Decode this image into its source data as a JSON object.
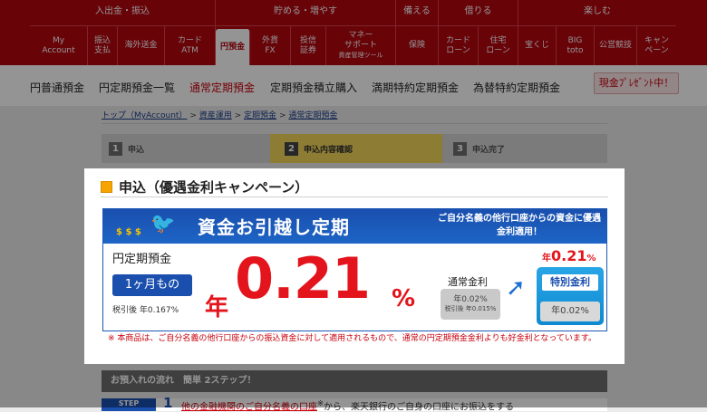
{
  "nav": {
    "categories": [
      "入出金・振込",
      "貯める・増やす",
      "備える",
      "借りる",
      "楽しむ"
    ],
    "items": [
      "My\nAccount",
      "振込\n支払",
      "海外送金",
      "カード\nATM",
      "円預金",
      "外貨\nFX",
      "投信\n証券",
      "マネー\nサポート",
      "保険",
      "カード\nローン",
      "住宅\nローン",
      "宝くじ",
      "BIG\ntoto",
      "公営競技",
      "キャン\nペーン"
    ],
    "money_support_sub": "資産管理ツール"
  },
  "subnav": {
    "links": [
      "円普通預金",
      "円定期預金一覧",
      "通常定期預金",
      "定期預金積立購入",
      "満期特約定期預金",
      "為替特約定期預金"
    ],
    "cash_button": "現金ﾌﾟﾚｾﾞﾝﾄ中！"
  },
  "breadcrumb": {
    "items": [
      "トップ（MyAccount）",
      "資産運用",
      "定期預金",
      "通常定期預金"
    ],
    "separator": ">"
  },
  "steps": [
    {
      "num": "1",
      "label": "申込"
    },
    {
      "num": "2",
      "label": "申込内容確認"
    },
    {
      "num": "3",
      "label": "申込完了"
    }
  ],
  "modal": {
    "heading": "申込（優遇金利キャンペーン）",
    "banner": {
      "coins": "$ $ $",
      "title": "資金お引越し定期",
      "subtitle": "ご自分名義の他行口座からの資金に優遇金利適用！",
      "plan": "円定期預金",
      "term": "1ヶ月もの",
      "after_tax": "税引後 年0.167%",
      "nen": "年",
      "rate": "0.21",
      "pct": "%",
      "normal_label": "通常金利",
      "normal_rate": "年0.02%",
      "normal_after_tax": "税引後 年0.015%",
      "special_top": "0.21",
      "special_top_prefix": "年",
      "special_top_suffix": "%",
      "special_label": "特別金利",
      "special_base": "年0.02%"
    },
    "note": "※ 本商品は、ご自分名義の他行口座からの振込資金に対して適用されるもので、通常の円定期預金金利よりも好金利となっています。"
  },
  "flow": {
    "title": "お預入れの流れ　簡単 2ステップ！",
    "step_badge": "STEP",
    "step_num": "1",
    "step_text_link": "他の金融機関のご自分名義の口座",
    "step_text_mark": "※",
    "step_text_rest": "から、楽天銀行のご自身の口座にお振込をする"
  }
}
